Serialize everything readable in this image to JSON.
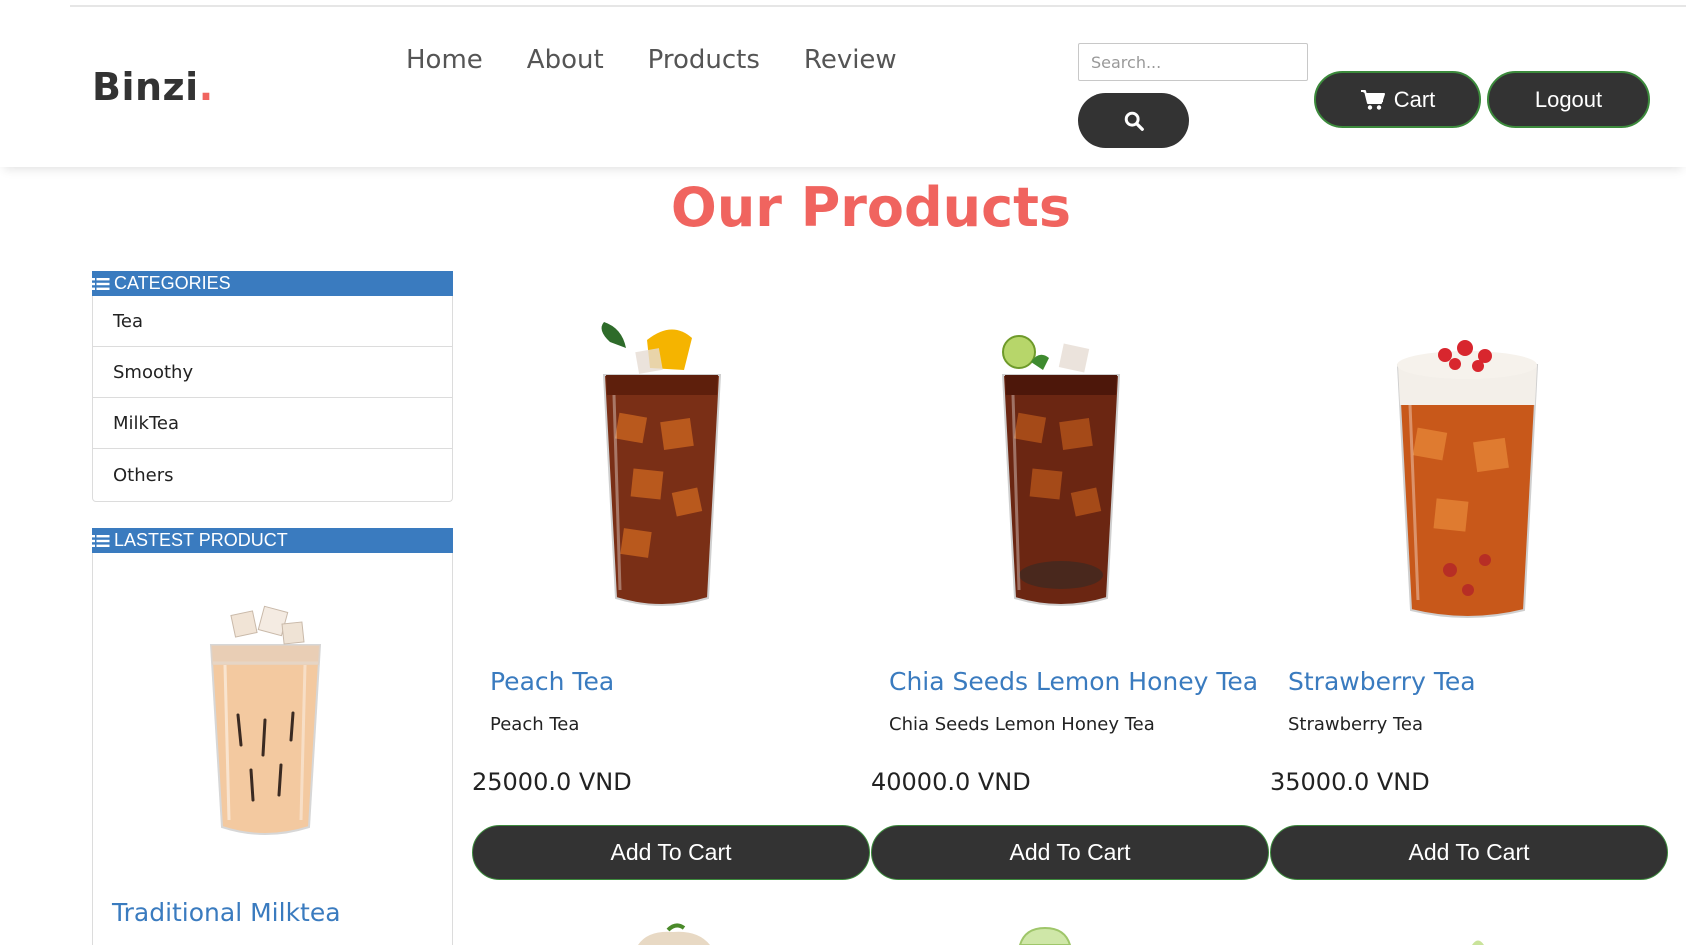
{
  "header": {
    "logo_text": "Binzi",
    "logo_dot": ".",
    "nav": [
      "Home",
      "About",
      "Products",
      "Review"
    ],
    "search_placeholder": "Search...",
    "cart_label": "Cart",
    "logout_label": "Logout"
  },
  "page_title": "Our Products",
  "sidebar": {
    "categories_title": "CATEGORIES",
    "categories": [
      "Tea",
      "Smoothy",
      "MilkTea",
      "Others"
    ],
    "latest_title": "LASTEST PRODUCT",
    "latest_product_name": "Traditional Milktea"
  },
  "products": [
    {
      "name": "Peach Tea",
      "desc": "Peach Tea",
      "price": "25000.0 VND",
      "button": "Add To Cart"
    },
    {
      "name": "Chia Seeds Lemon Honey Tea",
      "desc": "Chia Seeds Lemon Honey Tea",
      "price": "40000.0 VND",
      "button": "Add To Cart"
    },
    {
      "name": "Strawberry Tea",
      "desc": "Strawberry Tea",
      "price": "35000.0 VND",
      "button": "Add To Cart"
    }
  ],
  "colors": {
    "accent": "#f0645f",
    "link": "#3a7bbf",
    "button": "#333333",
    "button_border": "#3c8a3c",
    "panel_header": "#3a7bbf"
  },
  "icons": [
    "search-icon",
    "cart-icon",
    "list-icon"
  ]
}
